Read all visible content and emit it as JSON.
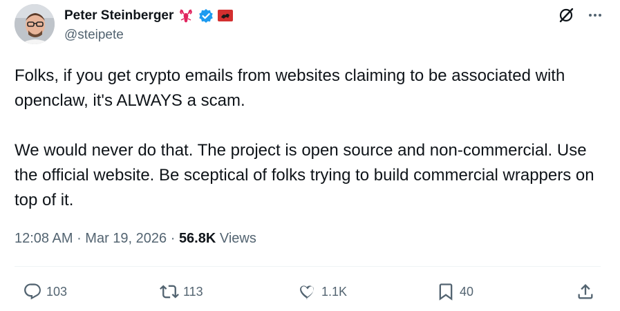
{
  "author": {
    "name": "Peter Steinberger",
    "handle": "@steipete",
    "badges": [
      "lobster-emoji-icon",
      "verified-badge-icon",
      "flag-emoji-icon"
    ],
    "colors": {
      "verified": "#1d9bf0",
      "lobster": "#e0245e",
      "flag": "#d32f2f"
    }
  },
  "tweet": {
    "paragraphs": [
      "Folks, if you get crypto emails from websites claiming to be associated with openclaw, it's ALWAYS a scam.",
      "We would never do that. The project is open source and non-commercial. Use the official website. Be sceptical of folks trying to build commercial wrappers on top of it."
    ],
    "time": "12:08 AM",
    "date": "Mar 19, 2026",
    "views_count": "56.8K",
    "views_label": "Views"
  },
  "actions": {
    "replies": "103",
    "reposts": "113",
    "likes": "1.1K",
    "bookmarks": "40"
  },
  "top_icons": [
    "grok-icon",
    "more-icon"
  ],
  "colors": {
    "text": "#0f1419",
    "muted": "#536471",
    "divider": "#eff3f4"
  }
}
